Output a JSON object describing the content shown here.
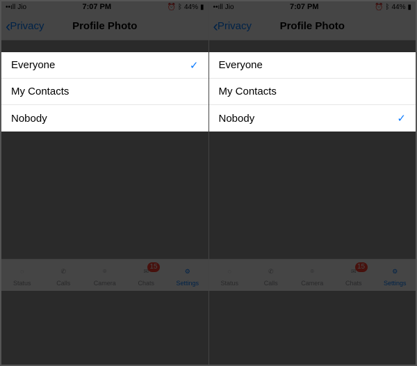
{
  "phones": [
    {
      "statusbar": {
        "carrier": "Jio",
        "time": "7:07 PM",
        "battery": "44%",
        "signal": "••ıll"
      },
      "navbar": {
        "back_label": "Privacy",
        "title": "Profile Photo"
      },
      "options": [
        {
          "label": "Everyone",
          "selected": true
        },
        {
          "label": "My Contacts",
          "selected": false
        },
        {
          "label": "Nobody",
          "selected": false
        }
      ],
      "tabs": [
        {
          "label": "Status",
          "icon": "status-icon",
          "active": false,
          "badge": ""
        },
        {
          "label": "Calls",
          "icon": "calls-icon",
          "active": false,
          "badge": ""
        },
        {
          "label": "Camera",
          "icon": "camera-icon",
          "active": false,
          "badge": ""
        },
        {
          "label": "Chats",
          "icon": "chats-icon",
          "active": false,
          "badge": "15"
        },
        {
          "label": "Settings",
          "icon": "settings-icon",
          "active": true,
          "badge": ""
        }
      ]
    },
    {
      "statusbar": {
        "carrier": "Jio",
        "time": "7:07 PM",
        "battery": "44%",
        "signal": "••ıll"
      },
      "navbar": {
        "back_label": "Privacy",
        "title": "Profile Photo"
      },
      "options": [
        {
          "label": "Everyone",
          "selected": false
        },
        {
          "label": "My Contacts",
          "selected": false
        },
        {
          "label": "Nobody",
          "selected": true
        }
      ],
      "tabs": [
        {
          "label": "Status",
          "icon": "status-icon",
          "active": false,
          "badge": ""
        },
        {
          "label": "Calls",
          "icon": "calls-icon",
          "active": false,
          "badge": ""
        },
        {
          "label": "Camera",
          "icon": "camera-icon",
          "active": false,
          "badge": ""
        },
        {
          "label": "Chats",
          "icon": "chats-icon",
          "active": false,
          "badge": "15"
        },
        {
          "label": "Settings",
          "icon": "settings-icon",
          "active": true,
          "badge": ""
        }
      ]
    }
  ],
  "icons": {
    "status-icon": "◌",
    "calls-icon": "✆",
    "camera-icon": "⌾",
    "chats-icon": "✉",
    "settings-icon": "⚙",
    "check-icon": "✓",
    "chevron-left-icon": "‹",
    "bluetooth-icon": "ᛒ",
    "alarm-icon": "⏰"
  }
}
